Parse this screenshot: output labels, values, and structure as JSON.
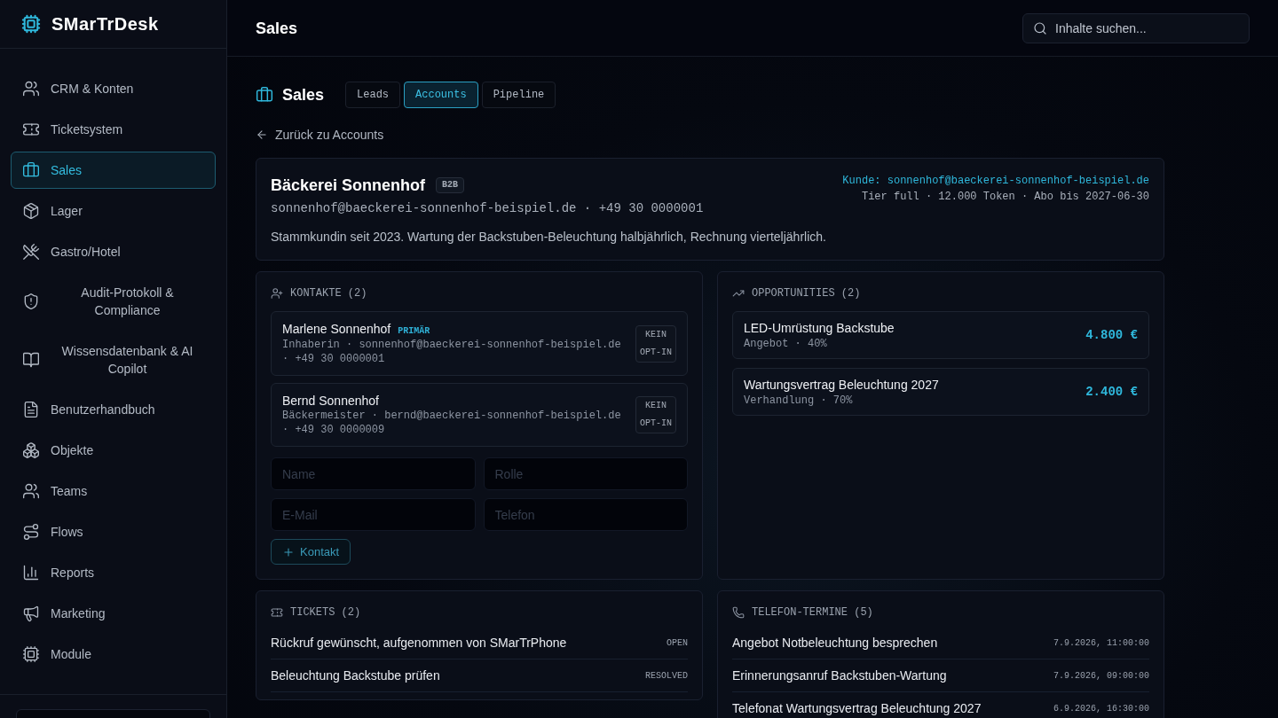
{
  "sidebar": {
    "brand": "SMarTrDesk",
    "items": [
      {
        "label": "CRM & Konten",
        "selected": false
      },
      {
        "label": "Ticketsystem",
        "selected": false
      },
      {
        "label": "Sales",
        "selected": true
      },
      {
        "label": "Lager",
        "selected": false
      },
      {
        "label": "Gastro/Hotel",
        "selected": false
      },
      {
        "label": "Audit-Protokoll & Compliance",
        "selected": false
      },
      {
        "label": "Wissensdatenbank & AI Copilot",
        "selected": false
      },
      {
        "label": "Benutzerhandbuch",
        "selected": false
      },
      {
        "label": "Objekte",
        "selected": false
      },
      {
        "label": "Teams",
        "selected": false
      },
      {
        "label": "Flows",
        "selected": false
      },
      {
        "label": "Reports",
        "selected": false
      },
      {
        "label": "Marketing",
        "selected": false
      },
      {
        "label": "Module",
        "selected": false
      }
    ]
  },
  "header": {
    "title": "Sales",
    "search": {
      "placeholder": "Inhalte suchen..."
    }
  },
  "page": {
    "title": "Sales",
    "tabs": [
      {
        "label": "Leads",
        "selected": false
      },
      {
        "label": "Accounts",
        "selected": true
      },
      {
        "label": "Pipeline",
        "selected": false
      }
    ],
    "back_link": "Zurück zu Accounts"
  },
  "account": {
    "name": "Bäckerei Sonnenhof",
    "badge": "B2B",
    "contact_line": "sonnenhof@baeckerei-sonnenhof-beispiel.de · +49 30 0000001",
    "note": "Stammkundin seit 2023. Wartung der Backstuben-Beleuchtung halbjährlich, Rechnung vierteljährlich.",
    "customer": "Kunde: sonnenhof@baeckerei-sonnenhof-beispiel.de",
    "plan": "Tier full · 12.000 Token · Abo bis 2027-06-30"
  },
  "contacts": {
    "title": "KONTAKTE (2)",
    "items": [
      {
        "name": "Marlene Sonnenhof",
        "badge": "PRIMÄR",
        "details": "Inhaberin · sonnenhof@baeckerei-sonnenhof-beispiel.de · +49 30 0000001",
        "consent": "KEIN OPT-IN"
      },
      {
        "name": "Bernd Sonnenhof",
        "details": "Bäckermeister · bernd@baeckerei-sonnenhof-beispiel.de · +49 30 0000009",
        "consent": "KEIN OPT-IN"
      }
    ],
    "form": {
      "fields": [
        {
          "placeholder": "Name"
        },
        {
          "placeholder": "Rolle"
        },
        {
          "placeholder": "E-Mail"
        },
        {
          "placeholder": "Telefon"
        }
      ],
      "add_button": "Kontakt"
    }
  },
  "opportunities": {
    "title": "OPPORTUNITIES (2)",
    "items": [
      {
        "title": "LED-Umrüstung Backstube",
        "details": "Angebot · 40%",
        "amount": "4.800 €"
      },
      {
        "title": "Wartungsvertrag Beleuchtung 2027",
        "details": "Verhandlung · 70%",
        "amount": "2.400 €"
      }
    ]
  },
  "tickets": {
    "title": "TICKETS (2)",
    "items": [
      {
        "title": "Rückruf gewünscht, aufgenommen von SMarTrPhone",
        "status": "OPEN"
      },
      {
        "title": "Beleuchtung Backstube prüfen",
        "status": "RESOLVED"
      }
    ]
  },
  "phone_appointments": {
    "title": "TELEFON-TERMINE (5)",
    "items": [
      {
        "title": "Angebot Notbeleuchtung besprechen",
        "time": "7.9.2026, 11:00:00"
      },
      {
        "title": "Erinnerungsanruf Backstuben-Wartung",
        "time": "7.9.2026, 09:00:00"
      },
      {
        "title": "Telefonat Wartungsvertrag Beleuchtung 2027",
        "time": "6.9.2026, 16:30:00"
      }
    ]
  }
}
